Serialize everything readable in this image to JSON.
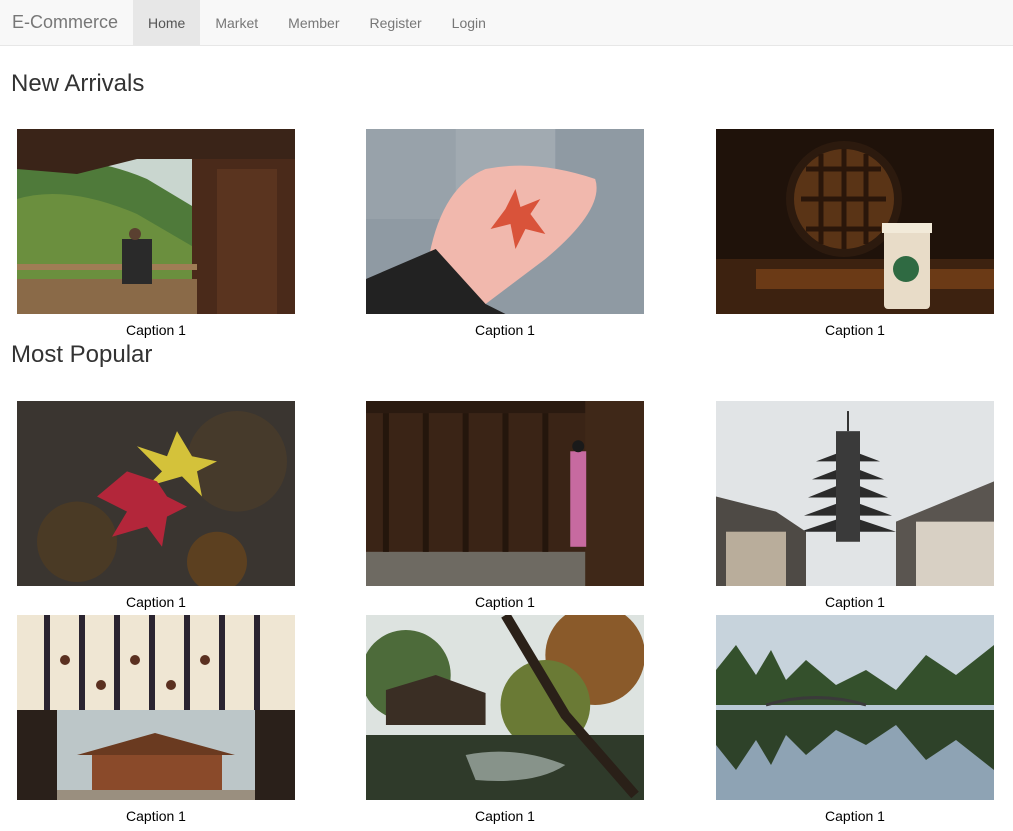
{
  "navbar": {
    "brand": "E-Commerce",
    "items": [
      {
        "label": "Home",
        "active": true
      },
      {
        "label": "Market",
        "active": false
      },
      {
        "label": "Member",
        "active": false
      },
      {
        "label": "Register",
        "active": false
      },
      {
        "label": "Login",
        "active": false
      }
    ]
  },
  "new_arrivals": {
    "title": "New Arrivals",
    "items": [
      {
        "caption": "Caption 1"
      },
      {
        "caption": "Caption 1"
      },
      {
        "caption": "Caption 1"
      }
    ]
  },
  "most_popular": {
    "title": "Most Popular",
    "items": [
      {
        "caption": "Caption 1"
      },
      {
        "caption": "Caption 1"
      },
      {
        "caption": "Caption 1"
      },
      {
        "caption": "Caption 1"
      },
      {
        "caption": "Caption 1"
      },
      {
        "caption": "Caption 1"
      }
    ]
  }
}
